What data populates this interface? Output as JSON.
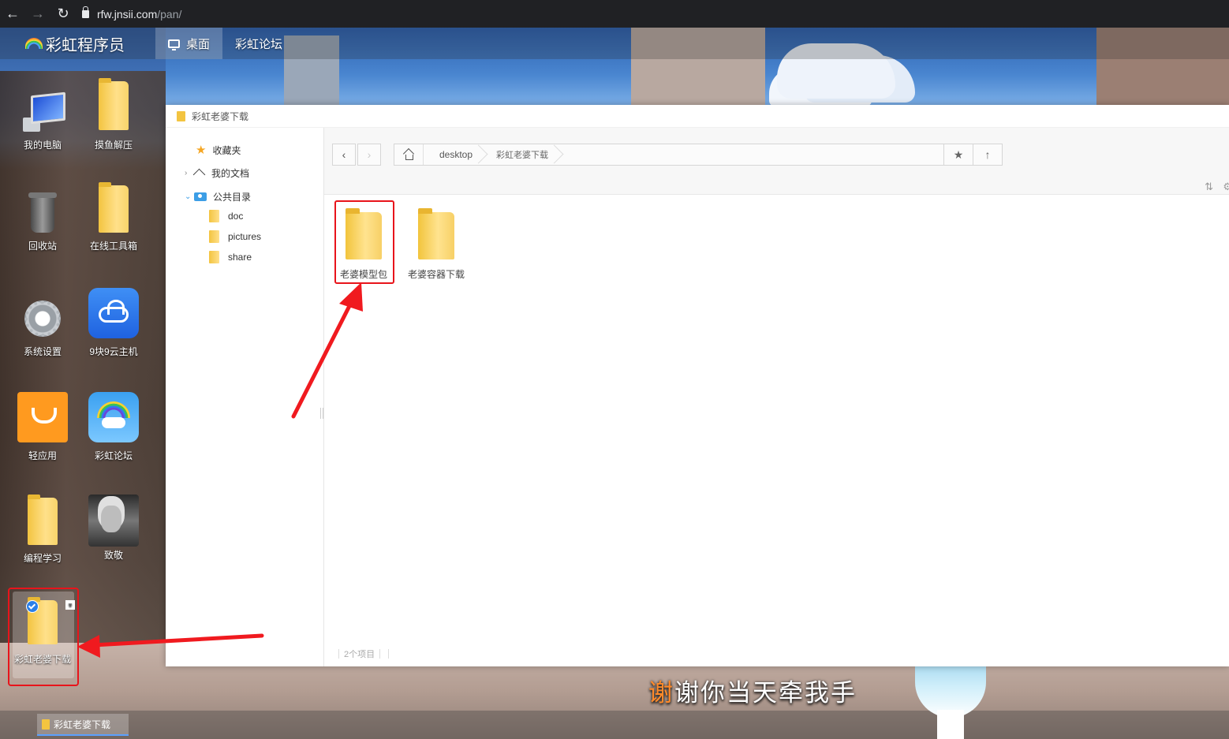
{
  "browser": {
    "back_icon": "arrow-left-icon",
    "forward_icon": "arrow-right-icon",
    "reload_icon": "reload-icon",
    "url_host": "rfw.jnsii.com",
    "url_path": "/pan/"
  },
  "top_menu": {
    "brand": "彩虹程序员",
    "items": [
      {
        "label": "桌面",
        "icon": "monitor-icon",
        "active": true
      },
      {
        "label": "彩虹论坛",
        "active": false
      }
    ]
  },
  "desktop": {
    "icons": [
      {
        "label": "我的电脑",
        "icon": "computer-icon"
      },
      {
        "label": "摸鱼解压",
        "icon": "folder-icon"
      },
      {
        "label": "回收站",
        "icon": "trash-icon"
      },
      {
        "label": "在线工具箱",
        "icon": "folder-icon"
      },
      {
        "label": "系统设置",
        "icon": "gear-icon"
      },
      {
        "label": "9块9云主机",
        "icon": "cloud-icon"
      },
      {
        "label": "轻应用",
        "icon": "shopping-bag-icon"
      },
      {
        "label": "彩虹论坛",
        "icon": "rainbow-icon"
      },
      {
        "label": "编程学习",
        "icon": "folder-icon"
      },
      {
        "label": "致敬",
        "icon": "portrait-icon"
      },
      {
        "label": "彩虹老婆下载",
        "icon": "folder-icon",
        "selected": true
      }
    ]
  },
  "taskbar": {
    "items": [
      {
        "label": "彩虹老婆下载"
      }
    ]
  },
  "subtitle": {
    "highlight": "谢",
    "rest": "谢你当天牵我手"
  },
  "explorer": {
    "title": "彩虹老婆下载",
    "sidebar": {
      "favorites": "收藏夹",
      "my_docs": "我的文档",
      "public_dir": "公共目录",
      "folders": [
        "doc",
        "pictures",
        "share"
      ]
    },
    "breadcrumb": [
      "desktop",
      "彩虹老婆下载"
    ],
    "files": [
      {
        "name": "老婆模型包",
        "highlighted": true
      },
      {
        "name": "老婆容器下载",
        "highlighted": false
      }
    ],
    "status": "2个项目"
  },
  "colors": {
    "annotation_red": "#e8141b",
    "folder_yellow": "#f3c440",
    "accent_blue": "#2b7fe8"
  }
}
